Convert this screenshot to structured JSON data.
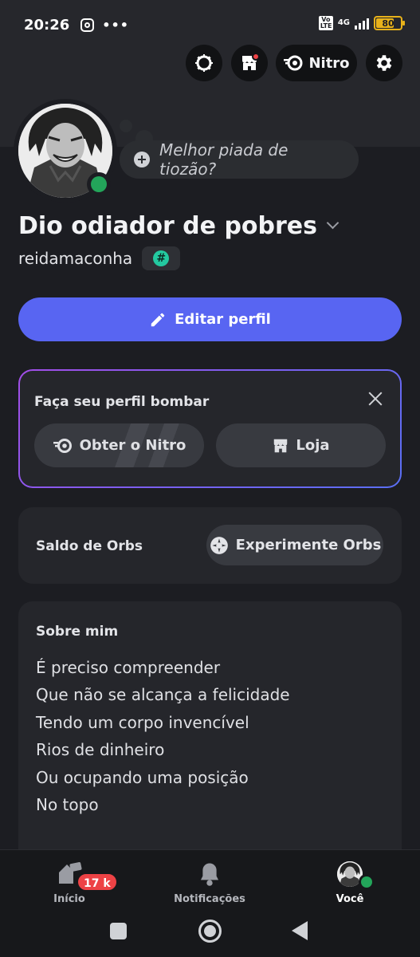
{
  "status_bar": {
    "time": "20:26",
    "network_badge": "Vo LTE",
    "network_type": "4G",
    "battery": "80"
  },
  "header": {
    "nitro_label": "Nitro"
  },
  "profile": {
    "thought_placeholder": "Melhor piada de tiozão?",
    "display_name": "Dio odiador de pobres",
    "username": "reidamaconha",
    "badge_symbol": "#",
    "edit_label": "Editar perfil"
  },
  "promo": {
    "title": "Faça seu perfil bombar",
    "nitro_label": "Obter o Nitro",
    "shop_label": "Loja"
  },
  "orbs": {
    "label": "Saldo de Orbs",
    "button_label": "Experimente Orbs"
  },
  "about": {
    "title": "Sobre mim",
    "lines": [
      "É preciso compreender",
      "Que não se alcança a felicidade",
      "Tendo um corpo invencível",
      "Rios de dinheiro",
      "Ou ocupando uma posição",
      "No topo"
    ]
  },
  "bottom_nav": {
    "home_label": "Início",
    "home_badge": "17 k",
    "notifications_label": "Notificações",
    "you_label": "Você"
  },
  "colors": {
    "accent": "#5865f2",
    "online": "#23a55a",
    "alert": "#ed4245",
    "background": "#1c1d22",
    "card": "#25262b"
  },
  "icons": [
    "instagram-icon",
    "more-icon",
    "signal-icon",
    "battery-icon",
    "quests-icon",
    "shop-icon",
    "nitro-icon",
    "gear-icon",
    "plus-circle-icon",
    "chevron-down-icon",
    "pencil-icon",
    "close-icon",
    "orb-icon",
    "home-icon",
    "bell-icon"
  ]
}
